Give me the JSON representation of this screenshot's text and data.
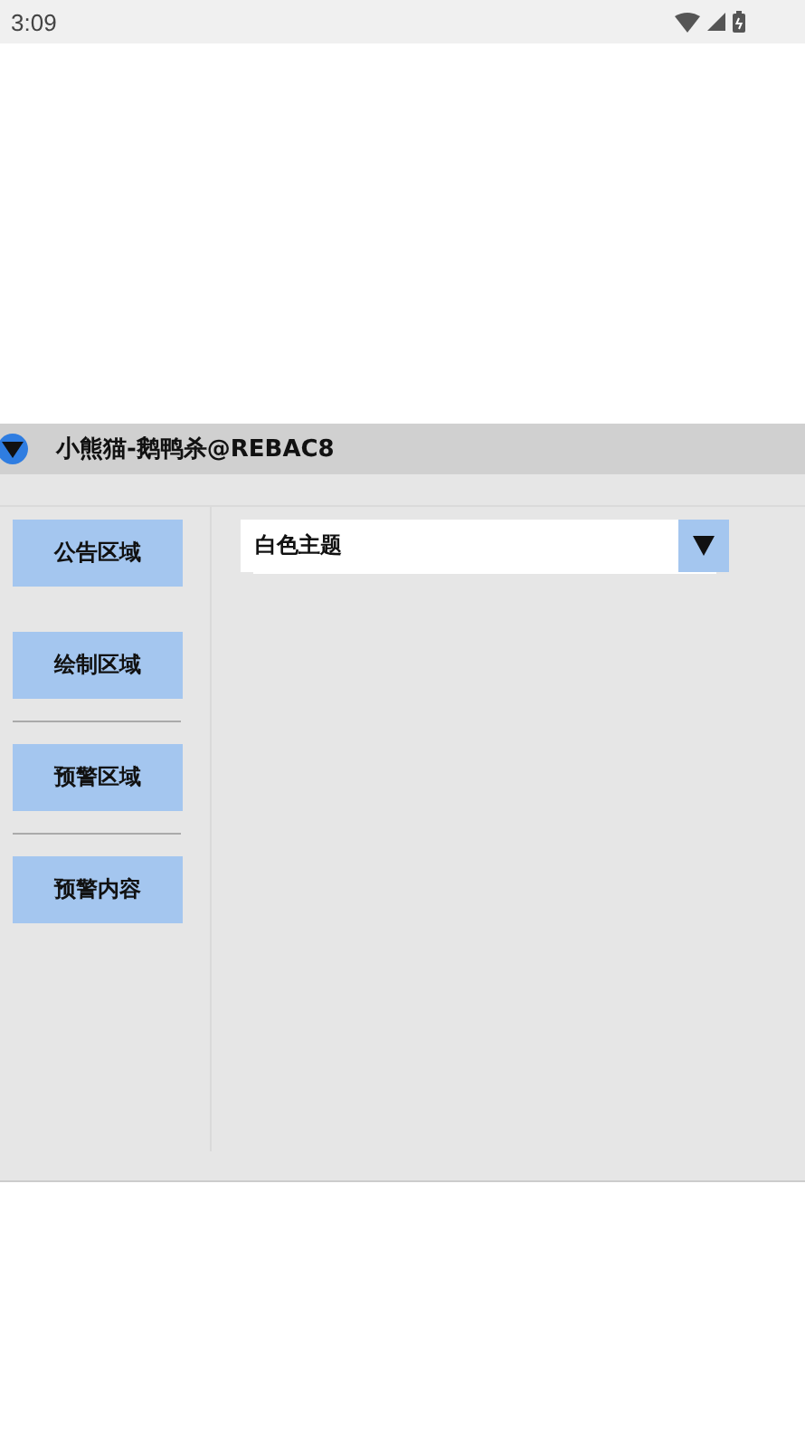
{
  "status_bar": {
    "time": "3:09"
  },
  "panel": {
    "title": "小熊猫-鹅鸭杀@REBAC8",
    "menu": [
      {
        "label": "公告区域",
        "divider_after": false
      },
      {
        "label": "绘制区域",
        "divider_after": true
      },
      {
        "label": "预警区域",
        "divider_after": true
      },
      {
        "label": "预警内容",
        "divider_after": false
      }
    ],
    "theme_select": {
      "value": "白色主题"
    }
  }
}
